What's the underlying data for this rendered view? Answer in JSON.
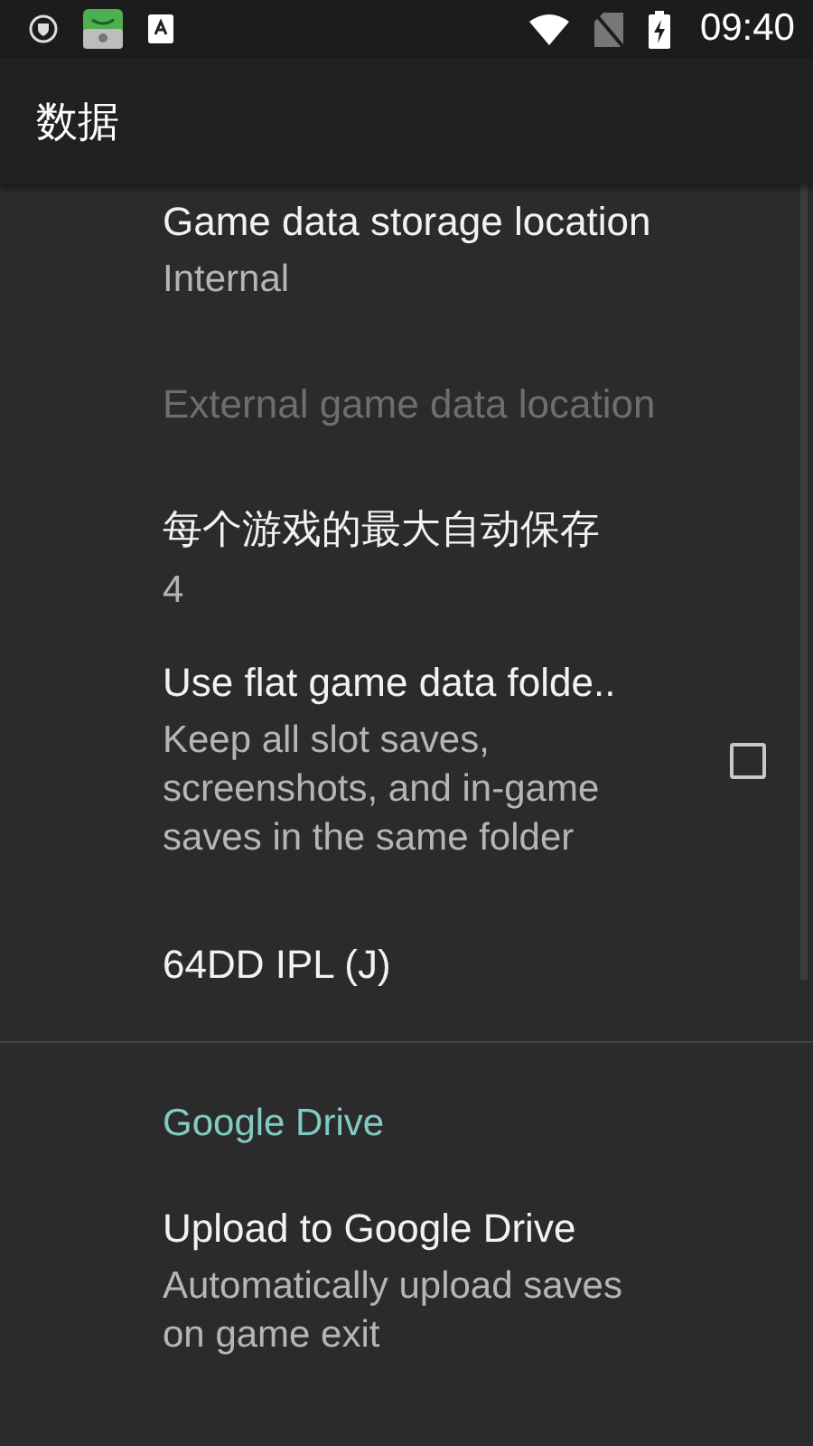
{
  "status_bar": {
    "time": "09:40"
  },
  "app_bar": {
    "title": "数据"
  },
  "preferences": [
    {
      "kind": "item",
      "title": "Game data storage location",
      "summary": "Internal",
      "disabled": false
    },
    {
      "kind": "item",
      "title": "External game data location",
      "disabled": true
    },
    {
      "kind": "item",
      "title": "每个游戏的最大自动保存",
      "summary": "4",
      "disabled": false
    },
    {
      "kind": "checkbox",
      "title": "Use flat game data folde..",
      "summary": "Keep all slot saves, screenshots, and in-game saves in the same folder",
      "checked": false,
      "disabled": false
    },
    {
      "kind": "item",
      "title": "64DD IPL (J)",
      "disabled": false
    },
    {
      "kind": "divider"
    },
    {
      "kind": "category",
      "title": "Google Drive"
    },
    {
      "kind": "item",
      "title": "Upload to Google Drive",
      "summary": "Automatically upload saves on game exit",
      "disabled": false
    }
  ]
}
